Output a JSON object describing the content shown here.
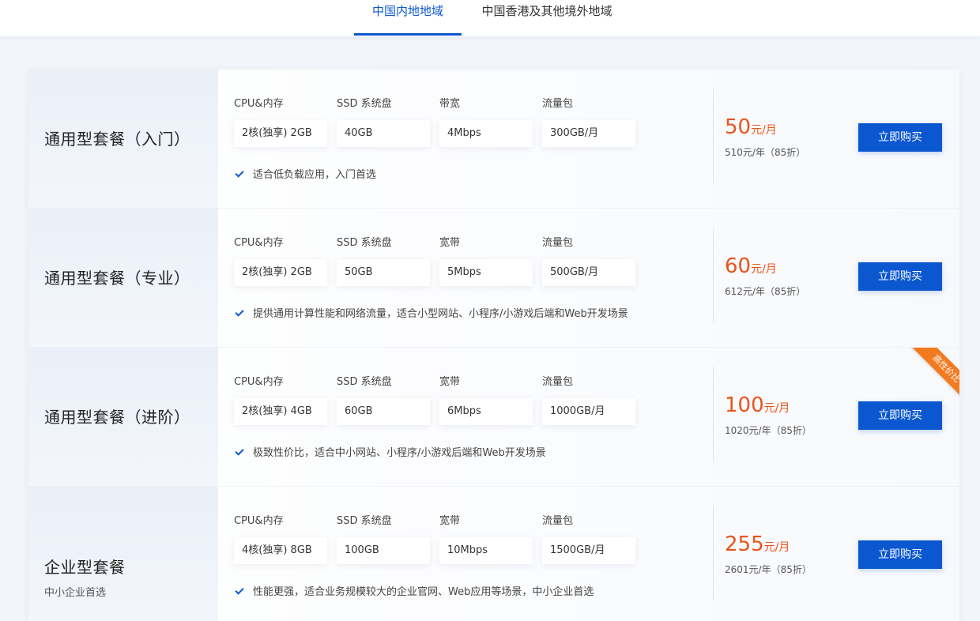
{
  "tabs": [
    {
      "label": "中国内地地域",
      "active": true
    },
    {
      "label": "中国香港及其他境外地域",
      "active": false
    }
  ],
  "colors": {
    "accent": "#0b57d0",
    "price": "#e9541e",
    "ribbon": "#f47a20"
  },
  "plans": [
    {
      "name": "通用型套餐（入门）",
      "subtitle": "",
      "specs": [
        {
          "label": "CPU&内存",
          "value": "2核(独享) 2GB"
        },
        {
          "label": "SSD 系统盘",
          "value": "40GB"
        },
        {
          "label": "带宽",
          "value": "4Mbps"
        },
        {
          "label": "流量包",
          "value": "300GB/月"
        }
      ],
      "feature": "适合低负载应用，入门首选",
      "price": "50",
      "price_unit": "元/月",
      "price_year": "510元/年（85折）",
      "buy_label": "立即购买",
      "ribbon": ""
    },
    {
      "name": "通用型套餐（专业）",
      "subtitle": "",
      "specs": [
        {
          "label": "CPU&内存",
          "value": "2核(独享) 2GB"
        },
        {
          "label": "SSD 系统盘",
          "value": "50GB"
        },
        {
          "label": "宽带",
          "value": "5Mbps"
        },
        {
          "label": "流量包",
          "value": "500GB/月"
        }
      ],
      "feature": "提供通用计算性能和网络流量，适合小型网站、小程序/小游戏后端和Web开发场景",
      "price": "60",
      "price_unit": "元/月",
      "price_year": "612元/年（85折）",
      "buy_label": "立即购买",
      "ribbon": ""
    },
    {
      "name": "通用型套餐（进阶）",
      "subtitle": "",
      "specs": [
        {
          "label": "CPU&内存",
          "value": "2核(独享) 4GB"
        },
        {
          "label": "SSD 系统盘",
          "value": "60GB"
        },
        {
          "label": "宽带",
          "value": "6Mbps"
        },
        {
          "label": "流量包",
          "value": "1000GB/月"
        }
      ],
      "feature": "极致性价比，适合中小网站、小程序/小游戏后端和Web开发场景",
      "price": "100",
      "price_unit": "元/月",
      "price_year": "1020元/年（85折）",
      "buy_label": "立即购买",
      "ribbon": "高性价比"
    },
    {
      "name": "企业型套餐",
      "subtitle": "中小企业首选",
      "specs": [
        {
          "label": "CPU&内存",
          "value": "4核(独享) 8GB"
        },
        {
          "label": "SSD 系统盘",
          "value": "100GB"
        },
        {
          "label": "宽带",
          "value": "10Mbps"
        },
        {
          "label": "流量包",
          "value": "1500GB/月"
        }
      ],
      "feature": "性能更强，适合业务规模较大的企业官网、Web应用等场景，中小企业首选",
      "price": "255",
      "price_unit": "元/月",
      "price_year": "2601元/年（85折）",
      "buy_label": "立即购买",
      "ribbon": ""
    }
  ]
}
